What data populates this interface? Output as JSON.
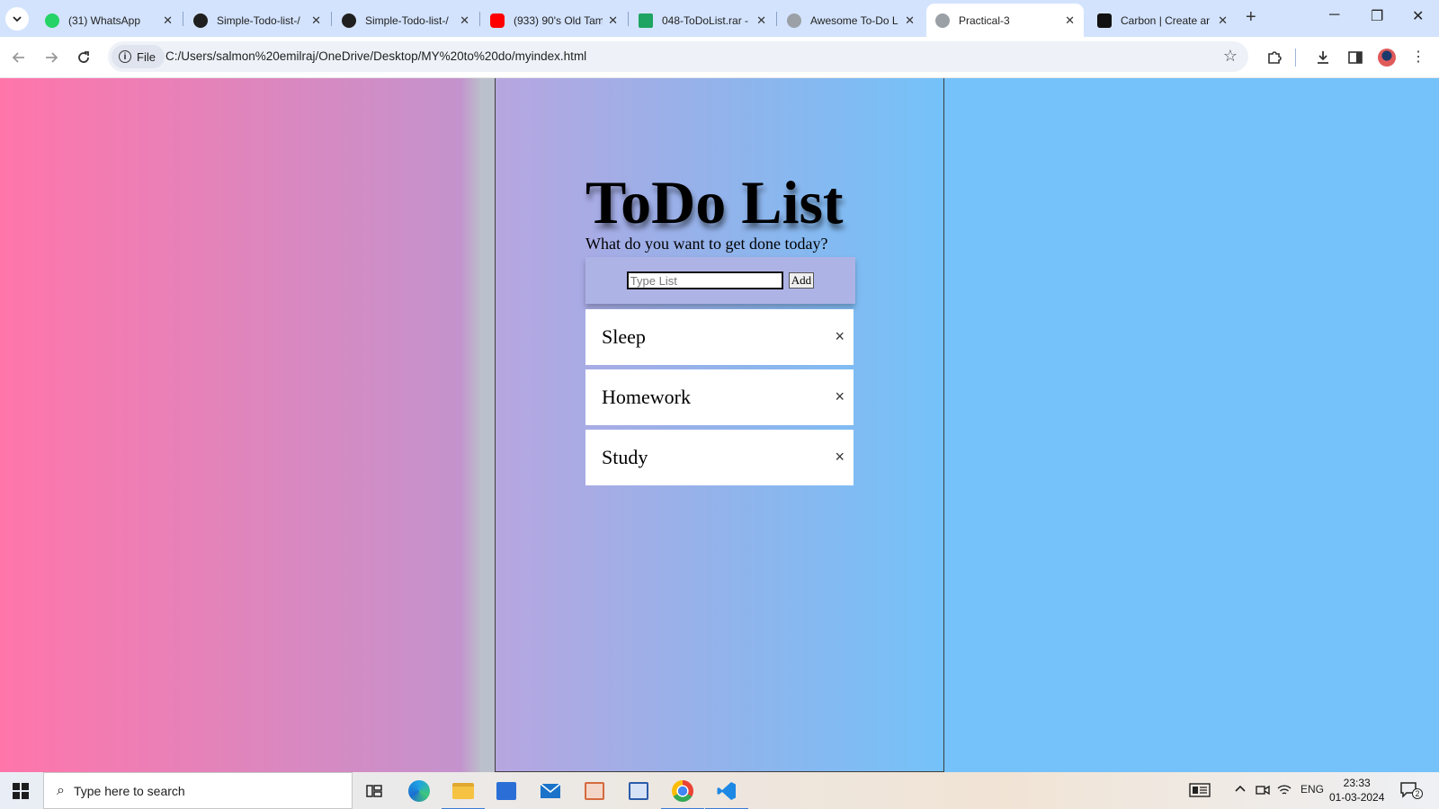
{
  "browser": {
    "tabs": [
      {
        "title": "(31) WhatsApp",
        "favicon": "whatsapp-icon",
        "color": "#25d366"
      },
      {
        "title": "Simple-Todo-list-/",
        "favicon": "github-icon",
        "color": "#1f1f1f"
      },
      {
        "title": "Simple-Todo-list-/",
        "favicon": "github-icon",
        "color": "#1f1f1f"
      },
      {
        "title": "(933) 90's Old Tam",
        "favicon": "youtube-icon",
        "color": "#ff0000"
      },
      {
        "title": "048-ToDoList.rar -",
        "favicon": "google-drive-icon",
        "color": "#1fa463"
      },
      {
        "title": "Awesome To-Do L",
        "favicon": "globe-icon",
        "color": "#9aa0a6"
      },
      {
        "title": "Practical-3",
        "favicon": "globe-icon",
        "color": "#9aa0a6",
        "active": true
      },
      {
        "title": "Carbon | Create ar",
        "favicon": "carbon-icon",
        "color": "#111111"
      }
    ],
    "address": {
      "scheme_label": "File",
      "url": "C:/Users/salmon%20emilraj/OneDrive/Desktop/MY%20to%20do/myindex.html"
    }
  },
  "page": {
    "title": "ToDo List",
    "subtitle": "What do you want to get done today?",
    "input_placeholder": "Type List",
    "add_label": "Add",
    "items": [
      "Sleep",
      "Homework",
      "Study"
    ],
    "remove_glyph": "×"
  },
  "taskbar": {
    "search_placeholder": "Type here to search",
    "language": "ENG",
    "time": "23:33",
    "date": "01-03-2024",
    "notification_count": "2"
  }
}
